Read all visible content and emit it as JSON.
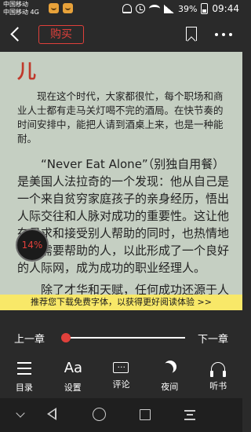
{
  "status_bar": {
    "carrier_1": "中国移动",
    "carrier_2": "中国移动 4G",
    "battery": "39%",
    "time": "09:44"
  },
  "app_bar": {
    "buy_label": "购买",
    "accent_color": "#e0403b"
  },
  "content": {
    "chapter_char": "儿",
    "paragraphs": [
      "现在这个时代，大家都很忙，每个职场和商业人士都有走马关灯喝不完的酒局。在快节奏的时间安排中，能把人请到酒桌上来，也是一种能耐。",
      "“Never Eat Alone”（别独自用餐）是美国人法拉奇的一个发现：他从自己是一个来自贫穷家庭孩子的亲身经历，悟出人际交往和人脉对成功的重要性。这让他在寻求和接受别人帮助的同时，也热情地帮助需要帮助的人，以此形成了一个良好的人际网，成为成功的职业经理人。",
      "除了才华和天赋，任何成功还源于人"
    ],
    "progress_label": "14%"
  },
  "banner": {
    "text": "推荐您下载免费字体，以获得更好阅读体验 >>"
  },
  "controls": {
    "prev_chapter": "上一章",
    "next_chapter": "下一章",
    "slider_value": 0
  },
  "toolbar": {
    "items": [
      {
        "label": "目录",
        "icon": "list-icon"
      },
      {
        "label": "设置",
        "icon": "font-icon",
        "glyph": "Aa"
      },
      {
        "label": "评论",
        "icon": "comment-icon"
      },
      {
        "label": "夜间",
        "icon": "moon-icon"
      },
      {
        "label": "听书",
        "icon": "headphone-icon"
      }
    ]
  }
}
